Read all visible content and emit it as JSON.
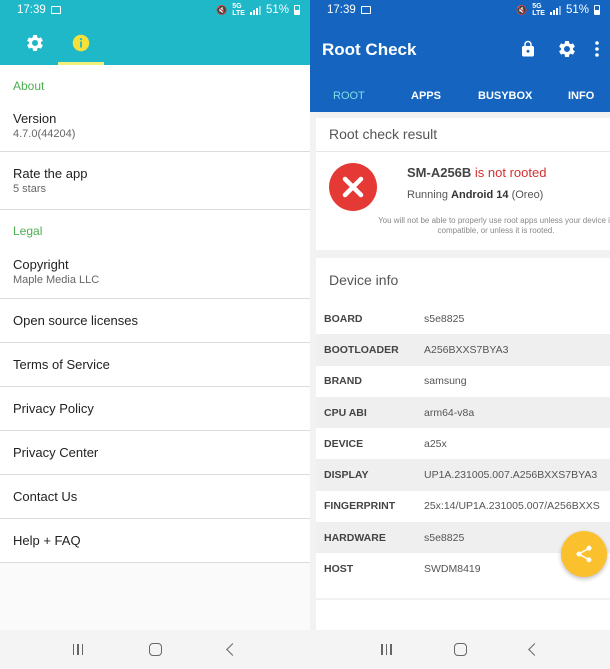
{
  "left": {
    "status": {
      "time": "17:39",
      "battery": "51%"
    },
    "tabs": [
      {
        "icon": "gear-icon",
        "active": false
      },
      {
        "icon": "info-icon",
        "active": true
      }
    ],
    "sections": {
      "about": "About",
      "legal": "Legal"
    },
    "items": {
      "version": {
        "title": "Version",
        "subtitle": "4.7.0(44204)"
      },
      "rate": {
        "title": "Rate the app",
        "subtitle": "5 stars"
      },
      "copyright": {
        "title": "Copyright",
        "subtitle": "Maple Media LLC"
      },
      "licenses": {
        "title": "Open source licenses"
      },
      "terms": {
        "title": "Terms of Service"
      },
      "privacy": {
        "title": "Privacy Policy"
      },
      "privacy_center": {
        "title": "Privacy Center"
      },
      "contact": {
        "title": "Contact Us"
      },
      "help": {
        "title": "Help + FAQ"
      }
    },
    "colors": {
      "toolbar": "#1fb8c8",
      "section": "#4caf50",
      "indicator": "#f3f07a"
    }
  },
  "right": {
    "status": {
      "time": "17:39",
      "battery": "51%"
    },
    "app_title": "Root Check",
    "toolbar_icons": [
      "lock-icon",
      "gear-icon",
      "more-vert-icon"
    ],
    "tabs": [
      {
        "label": "ROOT",
        "active": true
      },
      {
        "label": "APPS",
        "active": false
      },
      {
        "label": "BUSYBOX",
        "active": false
      },
      {
        "label": "INFO",
        "active": false
      }
    ],
    "result": {
      "heading": "Root check result",
      "device": "SM-A256B",
      "status": "is not rooted",
      "running_prefix": "Running",
      "android": "Android 14",
      "android_suffix": "(Oreo)",
      "warning": "You will not be able to properly use root apps unless your device is compatible, or unless it is rooted."
    },
    "device_info": {
      "heading": "Device info",
      "rows": [
        {
          "key": "BOARD",
          "value": "s5e8825"
        },
        {
          "key": "BOOTLOADER",
          "value": "A256BXXS7BYA3"
        },
        {
          "key": "BRAND",
          "value": "samsung"
        },
        {
          "key": "CPU ABI",
          "value": "arm64-v8a"
        },
        {
          "key": "DEVICE",
          "value": "a25x"
        },
        {
          "key": "DISPLAY",
          "value": "UP1A.231005.007.A256BXXS7BYA3"
        },
        {
          "key": "FINGERPRINT",
          "value": "25x:14/UP1A.231005.007/A256BXXS"
        },
        {
          "key": "HARDWARE",
          "value": "s5e8825"
        },
        {
          "key": "HOST",
          "value": "SWDM8419"
        }
      ]
    },
    "colors": {
      "toolbar": "#1565c0",
      "error": "#d32f2f",
      "fab": "#fbc02d",
      "active_tab": "#7fdde6"
    }
  }
}
